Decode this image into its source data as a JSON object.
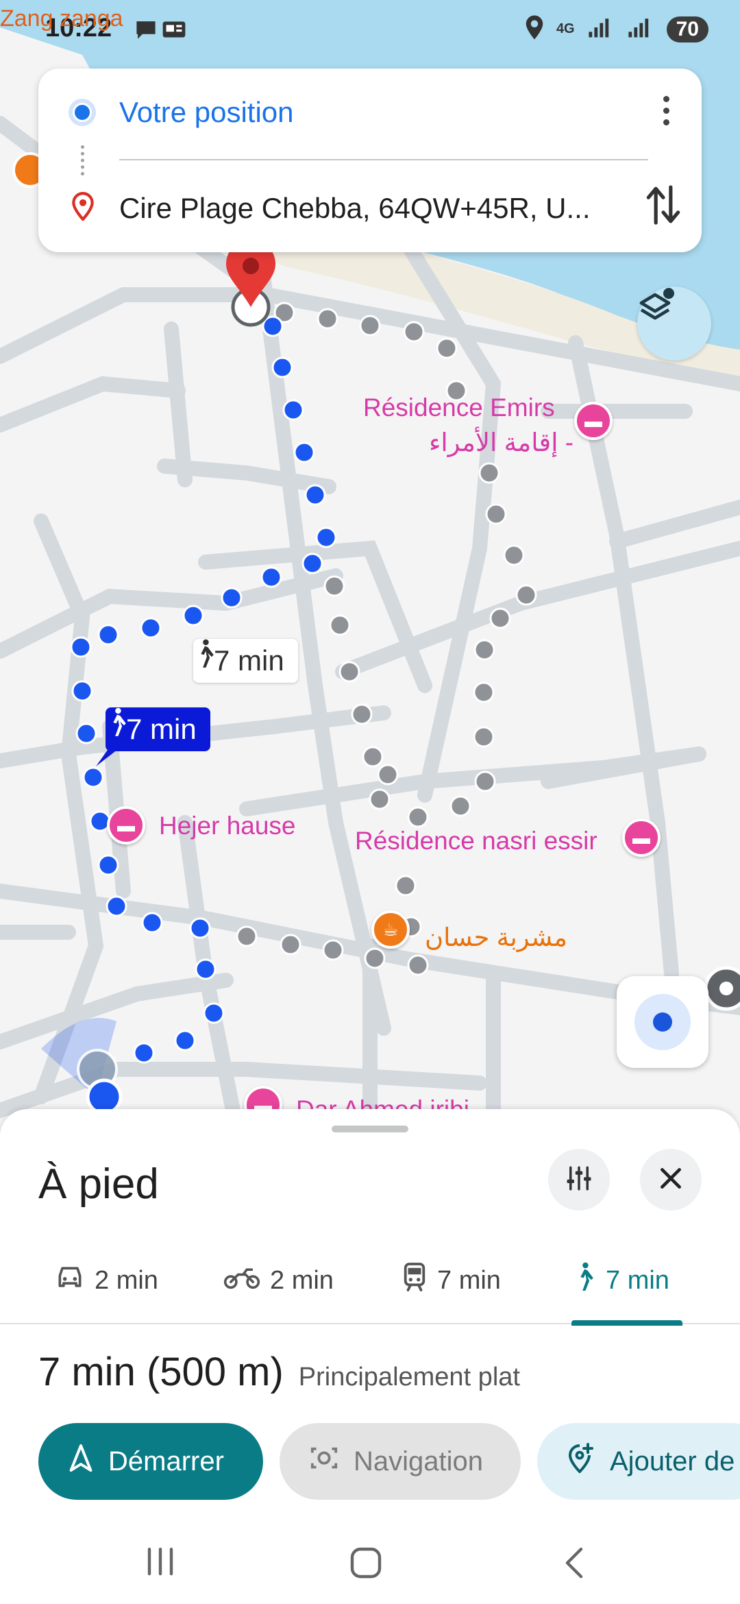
{
  "status_bar": {
    "time": "10:22",
    "watermark": "Zang zanga",
    "network": "4G",
    "battery": "70"
  },
  "route_card": {
    "origin": "Votre position",
    "destination": "Cire Plage Chebba, 64QW+45R, U..."
  },
  "map": {
    "pois": [
      {
        "name": "Résidence Emirs",
        "subname": "إقامة الأمراء -",
        "color": "#d63aa8"
      },
      {
        "name": "Hejer hause",
        "color": "#d63aa8"
      },
      {
        "name": "Résidence nasri essir",
        "color": "#d63aa8"
      },
      {
        "name": "مشربة حسان",
        "color": "#e8710a"
      },
      {
        "name": "Dar Ahmed jribi",
        "color": "#d63aa8"
      }
    ],
    "callout_alt": "7 min",
    "callout_selected": "7 min",
    "route_color": "#1a56f0",
    "alt_route_color": "#8f9398"
  },
  "sheet": {
    "title": "À pied",
    "modes": [
      {
        "icon": "car-icon",
        "label": "2 min"
      },
      {
        "icon": "motorcycle-icon",
        "label": "2 min"
      },
      {
        "icon": "transit-icon",
        "label": "7 min"
      },
      {
        "icon": "walk-icon",
        "label": "7 min",
        "active": true
      }
    ],
    "summary_main": "7 min (500 m)",
    "summary_sub": "Principalement plat",
    "actions": {
      "start": "Démarrer",
      "navigation": "Navigation",
      "add": "Ajouter de"
    },
    "accent": "#0a7c86"
  }
}
